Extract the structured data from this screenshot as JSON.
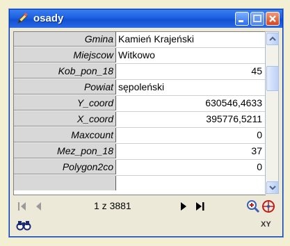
{
  "window": {
    "title": "osady",
    "icon": "pencil-icon",
    "controls": [
      "minimize-icon",
      "maximize-icon",
      "close-icon"
    ]
  },
  "attributes": [
    {
      "field": "Gmina",
      "value": "Kamień Krajeński",
      "align": "left"
    },
    {
      "field": "Miejscow",
      "value": "Witkowo",
      "align": "left"
    },
    {
      "field": "Kob_pon_18",
      "value": "45",
      "align": "right"
    },
    {
      "field": "Powiat",
      "value": "sępoleński",
      "align": "left"
    },
    {
      "field": "Y_coord",
      "value": "630546,4633",
      "align": "right"
    },
    {
      "field": "X_coord",
      "value": "395776,5211",
      "align": "right"
    },
    {
      "field": "Maxcount",
      "value": "0",
      "align": "right"
    },
    {
      "field": "Mez_pon_18",
      "value": "37",
      "align": "right"
    },
    {
      "field": "Polygon2co",
      "value": "0",
      "align": "right"
    }
  ],
  "navigation": {
    "record_indicator": "1 z 3881",
    "icons": [
      "first-record-icon",
      "previous-record-icon",
      "next-record-icon",
      "last-record-icon",
      "zoom-to-icon",
      "pan-to-icon"
    ]
  },
  "bottom": {
    "find_icon": "binoculars-icon",
    "xy_label": "XY"
  }
}
